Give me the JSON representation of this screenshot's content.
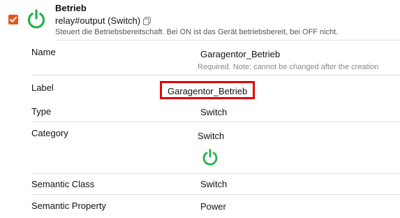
{
  "header": {
    "checked": true,
    "icon": "power-icon",
    "title": "Betrieb",
    "subtitle": "relay#output (Switch)",
    "description": "Steuert die Betriebsbereitschaft. Bei ON ist das Gerät betriebsbereit, bei OFF nicht."
  },
  "properties": {
    "name": {
      "label": "Name",
      "value": "Garagentor_Betrieb",
      "note": "Required. Note: cannot be changed after the creation"
    },
    "label": {
      "label": "Label",
      "value": "Garagentor_Betrieb"
    },
    "type": {
      "label": "Type",
      "value": "Switch"
    },
    "category": {
      "label": "Category",
      "value": "Switch",
      "icon": "power-icon"
    },
    "semantic_class": {
      "label": "Semantic Class",
      "value": "Switch"
    },
    "semantic_property": {
      "label": "Semantic Property",
      "value": "Power"
    }
  },
  "colors": {
    "accent": "#e8561a",
    "icon_green": "#22b14c",
    "highlight": "#e00000"
  }
}
